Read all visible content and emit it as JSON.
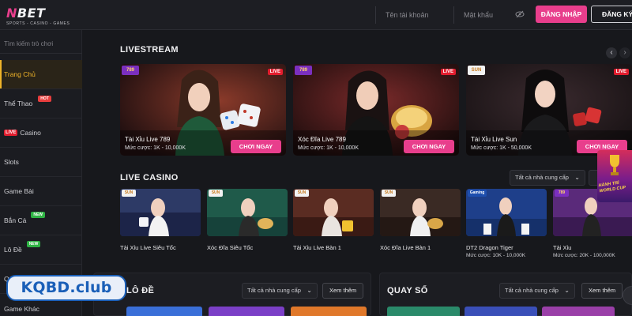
{
  "header": {
    "logo_text_a": "N",
    "logo_text_b": "BET",
    "logo_sub": "SPORTS - CASINO - GAMES",
    "username_placeholder": "Tên tài khoản",
    "password_placeholder": "Mật khẩu",
    "login_label": "ĐĂNG NHẬP",
    "register_label": "ĐĂNG KÝ",
    "accent": "#e83e8c"
  },
  "sidebar": {
    "search_placeholder": "Tìm kiếm trò chơi",
    "items": [
      {
        "label": "Trang Chủ"
      },
      {
        "label": "Thể Thao",
        "badge": "HOT"
      },
      {
        "label": "Casino",
        "tag": "LIVE"
      },
      {
        "label": "Slots"
      },
      {
        "label": "Game Bài"
      },
      {
        "label": "Bắn Cá",
        "badge": "NEW"
      },
      {
        "label": "Lô Đề",
        "badge": "NEW"
      },
      {
        "label": "Quay Số"
      },
      {
        "label": "Game Khác"
      }
    ]
  },
  "livestream": {
    "title": "LIVESTREAM",
    "cards": [
      {
        "provider": "789",
        "live": "LIVE",
        "name": "Tài Xỉu Live 789",
        "bet": "Mức cược: 1K - 10,000K",
        "cta": "CHƠI NGAY"
      },
      {
        "provider": "789",
        "live": "LIVE",
        "name": "Xóc Đĩa Live 789",
        "bet": "Mức cược: 1K - 10,000K",
        "cta": "CHƠI NGAY"
      },
      {
        "provider": "SUN",
        "live": "LIVE",
        "name": "Tài Xỉu Live Sun",
        "bet": "Mức cược: 1K - 50,000K",
        "cta": "CHƠI NGAY"
      }
    ]
  },
  "live_casino": {
    "title": "LIVE CASINO",
    "provider_filter": "Tất cả nhà cung cấp",
    "games": [
      {
        "provider": "SUN",
        "name": "Tài Xỉu Live Siêu Tốc",
        "bet": ""
      },
      {
        "provider": "SUN",
        "name": "Xóc Đĩa Siêu Tốc",
        "bet": ""
      },
      {
        "provider": "SUN",
        "name": "Tài Xỉu Live Bàn 1",
        "bet": ""
      },
      {
        "provider": "SUN",
        "name": "Xóc Đĩa Live Bàn 1",
        "bet": ""
      },
      {
        "provider": "Gaming",
        "name": "DT2 Dragon Tiger",
        "bet": "Mức cược: 10K - 10,000K"
      },
      {
        "provider": "789",
        "name": "Tài Xỉu",
        "bet": "Mức cược: 20K - 100,000K"
      }
    ]
  },
  "lo_de": {
    "title": "LÔ ĐỀ",
    "provider_filter": "Tất cả nhà cung cấp",
    "more_label": "Xem thêm"
  },
  "quay_so": {
    "title": "QUAY SỐ",
    "provider_filter": "Tất cả nhà cung cấp",
    "more_label": "Xem thêm"
  },
  "overlays": {
    "watermark": "KQBD.club",
    "promo_text_1": "HÀNH TRÌ",
    "promo_text_2": "WORLD CUP"
  }
}
